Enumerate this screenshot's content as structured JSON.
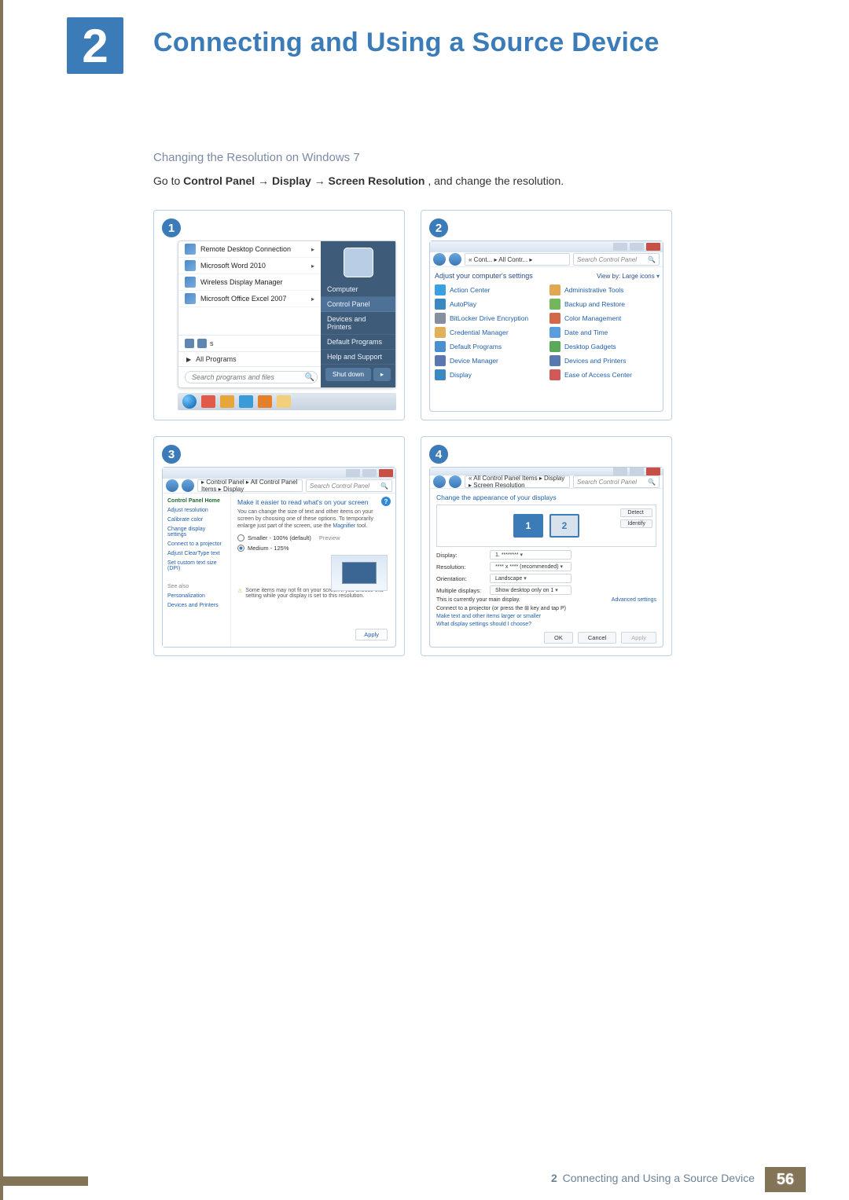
{
  "chapter": {
    "number": "2",
    "title": "Connecting and Using a Source Device"
  },
  "section": {
    "subtitle": "Changing the Resolution on Windows 7"
  },
  "instruction": {
    "lead": "Go to ",
    "path1": "Control Panel",
    "arrow": " → ",
    "path2": "Display",
    "path3": "Screen Resolution",
    "tail": ", and change the resolution."
  },
  "steps": {
    "one": "1",
    "two": "2",
    "three": "3",
    "four": "4"
  },
  "start_menu": {
    "items": [
      {
        "label": "Remote Desktop Connection",
        "submenu": true
      },
      {
        "label": "Microsoft Word 2010",
        "submenu": true
      },
      {
        "label": "Wireless Display Manager",
        "submenu": false
      },
      {
        "label": "Microsoft Office Excel 2007",
        "submenu": true
      }
    ],
    "corner_tile": "s",
    "all_programs": "All Programs",
    "search_placeholder": "Search programs and files",
    "right_panel": [
      "Computer",
      "Control Panel",
      "Devices and Printers",
      "Default Programs",
      "Help and Support"
    ],
    "right_highlight_index": 1,
    "shutdown": "Shut down"
  },
  "control_panel": {
    "breadcrumb": "« Cont... ▸ All Contr... ▸",
    "search_placeholder": "Search Control Panel",
    "heading": "Adjust your computer's settings",
    "view_by": "View by:   Large icons",
    "items_left": [
      "Action Center",
      "AutoPlay",
      "BitLocker Drive Encryption",
      "Credential Manager",
      "Default Programs",
      "Device Manager",
      "Display"
    ],
    "items_right": [
      "Administrative Tools",
      "Backup and Restore",
      "Color Management",
      "Date and Time",
      "Desktop Gadgets",
      "Devices and Printers",
      "Ease of Access Center"
    ]
  },
  "display_panel": {
    "breadcrumb": "▸ Control Panel ▸ All Control Panel Items ▸ Display",
    "search_placeholder": "Search Control Panel",
    "side_heading": "Control Panel Home",
    "side_links": [
      "Adjust resolution",
      "Calibrate color",
      "Change display settings",
      "Connect to a projector",
      "Adjust ClearType text",
      "Set custom text size (DPI)"
    ],
    "see_also": "See also",
    "see_also_links": [
      "Personalization",
      "Devices and Printers"
    ],
    "main_heading": "Make it easier to read what's on your screen",
    "main_sub_a": "You can change the size of text and other items on your screen by choosing one of these options. To temporarily enlarge just part of the screen, use the ",
    "main_sub_link": "Magnifier",
    "main_sub_b": " tool.",
    "opt_small": "Smaller - 100% (default)",
    "opt_small_note": "Preview",
    "opt_medium": "Medium - 125%",
    "note_text": "Some items may not fit on your screen if you choose this setting while your display is set to this resolution.",
    "apply": "Apply"
  },
  "resolution_panel": {
    "breadcrumb": "« All Control Panel Items ▸ Display ▸ Screen Resolution",
    "search_placeholder": "Search Control Panel",
    "heading": "Change the appearance of your displays",
    "monitor_a": "1",
    "monitor_b": "2",
    "btn_detect": "Detect",
    "btn_identify": "Identify",
    "rows": {
      "display_k": "Display:",
      "display_v": "1. ********",
      "resolution_k": "Resolution:",
      "resolution_v": "**** x **** (recommended)",
      "orientation_k": "Orientation:",
      "orientation_v": "Landscape",
      "multi_k": "Multiple displays:",
      "multi_v": "Show desktop only on 1"
    },
    "msg_main": "This is currently your main display.",
    "advanced": "Advanced settings",
    "msg_proj_a": "Connect to a projector",
    "msg_proj_b": " (or press the ⊞ key and tap P)",
    "link_larger": "Make text and other items larger or smaller",
    "link_what": "What display settings should I choose?",
    "btn_ok": "OK",
    "btn_cancel": "Cancel",
    "btn_apply": "Apply"
  },
  "footer": {
    "prefix": "2",
    "title": "Connecting and Using a Source Device",
    "page": "56"
  }
}
